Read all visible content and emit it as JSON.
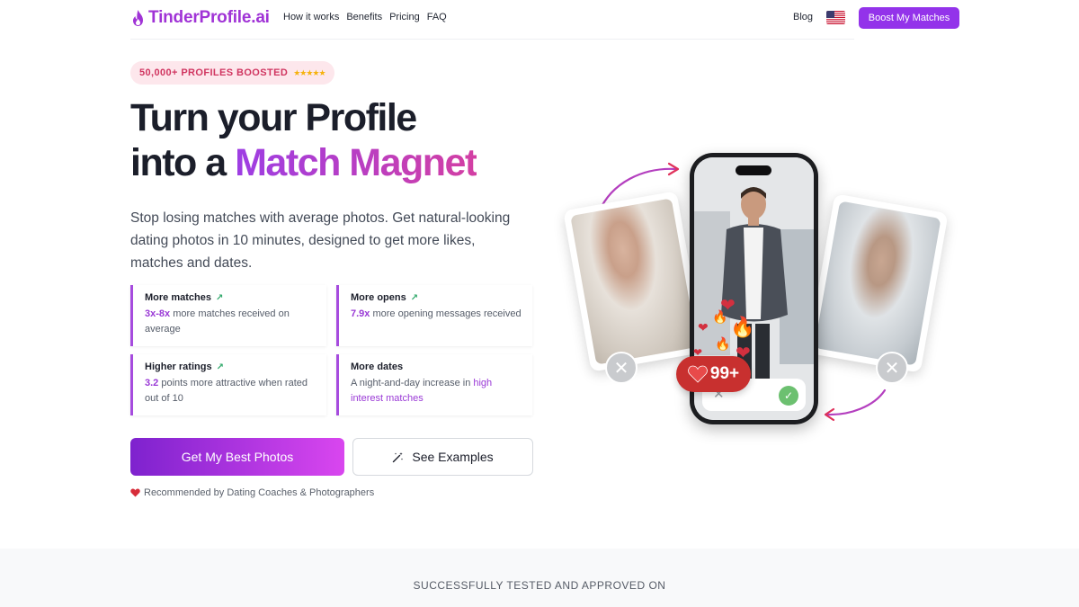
{
  "nav": {
    "logo": "TinderProfile.ai",
    "links": [
      "How it works",
      "Benefits",
      "Pricing",
      "FAQ"
    ],
    "blog": "Blog",
    "flag_icon": "us-flag-icon",
    "cta": "Boost My Matches"
  },
  "hero": {
    "badge": "50,000+ PROFILES BOOSTED",
    "badge_stars": "★★★★★",
    "title_line1": "Turn your Profile",
    "title_line2_plain": "into a ",
    "title_line2_highlight": "Match Magnet",
    "subtitle": "Stop losing matches with average photos. Get natural-looking dating photos in 10 minutes, designed to get more likes, matches and dates."
  },
  "stats": [
    {
      "title": "More matches",
      "highlight": "3x-8x",
      "text": " more matches received on average"
    },
    {
      "title": "More opens",
      "highlight": "7.9x",
      "text": " more opening messages received"
    },
    {
      "title": "Higher ratings",
      "highlight": "3.2",
      "text": " points more attractive when rated out of 10"
    },
    {
      "title": "More dates",
      "text": "A night-and-day increase in ",
      "highlight_tail": "high interest matches"
    }
  ],
  "buttons": {
    "primary": "Get My Best Photos",
    "secondary": "See Examples",
    "secondary_icon": "magic-wand-icon"
  },
  "recommend": "Recommended by Dating Coaches & Photographers",
  "illustration": {
    "counter": "99+"
  },
  "tested_on": "SUCCESSFULLY TESTED AND APPROVED ON",
  "colors": {
    "brand": "#9333ea",
    "badge_text": "#d03560",
    "accent_pink": "#d946ef"
  }
}
